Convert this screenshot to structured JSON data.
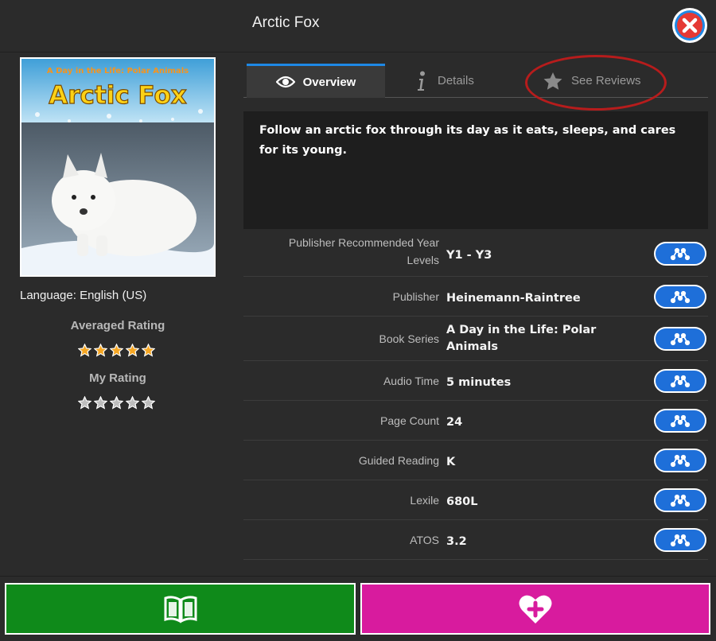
{
  "header": {
    "title": "Arctic Fox"
  },
  "book": {
    "cover_series": "A Day in the Life: Polar Animals",
    "cover_title": "Arctic Fox",
    "language": "Language: English (US)"
  },
  "ratings": {
    "averaged_label": "Averaged Rating",
    "averaged_value": 5,
    "my_label": "My Rating",
    "my_value": 0,
    "max": 5
  },
  "tabs": {
    "overview": "Overview",
    "details": "Details",
    "reviews": "See Reviews"
  },
  "description": "Follow an arctic fox through its day as it eats, sleeps, and cares for its young.",
  "details": [
    {
      "label": "Publisher Recommended Year Levels",
      "value": "Y1 - Y3"
    },
    {
      "label": "Publisher",
      "value": "Heinemann-Raintree"
    },
    {
      "label": "Book Series",
      "value": "A Day in the Life: Polar Animals"
    },
    {
      "label": "Audio Time",
      "value": "5 minutes"
    },
    {
      "label": "Page Count",
      "value": "24"
    },
    {
      "label": "Guided Reading",
      "value": "K"
    },
    {
      "label": "Lexile",
      "value": "680L"
    },
    {
      "label": "ATOS",
      "value": "3.2"
    }
  ],
  "colors": {
    "accent_blue": "#1e88e5",
    "read_green": "#0f8a1a",
    "favorite_pink": "#d81b9e",
    "star_orange": "#f5a623",
    "highlight_red": "#b71c1c"
  },
  "icons": {
    "close": "close-x-icon",
    "overview": "eye-icon",
    "details": "info-icon",
    "reviews": "star-icon",
    "row_button": "related-network-icon",
    "read": "open-book-icon",
    "favorite": "heart-plus-icon"
  }
}
